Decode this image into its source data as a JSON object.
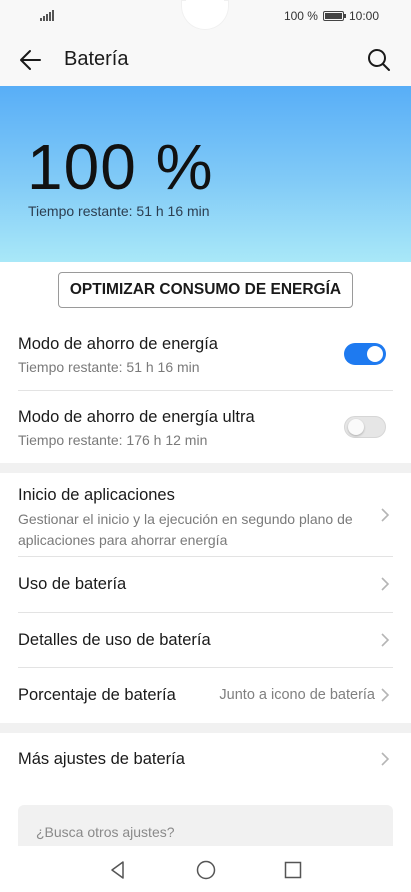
{
  "status_bar": {
    "battery_text": "100 %",
    "time": "10:00"
  },
  "app_bar": {
    "title": "Batería",
    "back_icon": "arrow-left-icon",
    "search_icon": "search-icon"
  },
  "header": {
    "percent": "100 %",
    "remaining": "Tiempo restante: 51 h 16 min",
    "level_fraction": 1.0
  },
  "optimize_button": {
    "label": "OPTIMIZAR CONSUMO DE ENERGÍA"
  },
  "power_modes": [
    {
      "label": "Modo de ahorro de energía",
      "sub": "Tiempo restante: 51 h 16 min",
      "enabled": true
    },
    {
      "label": "Modo de ahorro de energía ultra",
      "sub": "Tiempo restante: 176 h 12 min",
      "enabled": false
    }
  ],
  "settings": [
    {
      "label": "Inicio de aplicaciones",
      "sub": "Gestionar el inicio y la ejecución en segundo plano de aplicaciones para ahorrar energía"
    },
    {
      "label": "Uso de batería"
    },
    {
      "label": "Detalles de uso de batería"
    },
    {
      "label": "Porcentaje de batería",
      "value": "Junto a icono de batería"
    }
  ],
  "more": {
    "label": "Más ajustes de batería"
  },
  "search_suggest": {
    "text": "¿Busca otros ajustes?"
  },
  "colors": {
    "accent": "#1e7af0",
    "header_top": "#58aef7",
    "header_bottom": "#a9e8f8"
  }
}
